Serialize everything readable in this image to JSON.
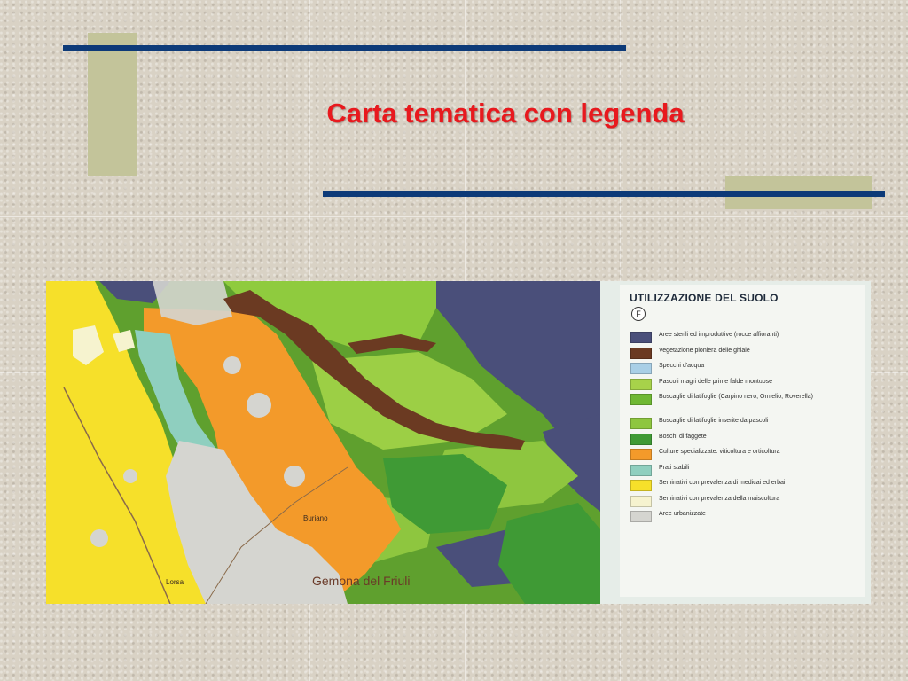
{
  "slide": {
    "title": "Carta tematica con legenda"
  },
  "map": {
    "place_labels": [
      "Gemona del Friuli",
      "Buriano",
      "Lorsa"
    ],
    "legend": {
      "title": "UTILIZZAZIONE DEL SUOLO",
      "badge": "F",
      "items": [
        {
          "color": "#4a4f7a",
          "label": "Aree sterili ed improduttive (rocce affioranti)"
        },
        {
          "color": "#6b3a22",
          "label": "Vegetazione pioniera delle ghiaie"
        },
        {
          "color": "#a9cfe6",
          "label": "Specchi d'acqua"
        },
        {
          "color": "#a7d24a",
          "label": "Pascoli magri delle prime falde montuose"
        },
        {
          "color": "#6fb833",
          "label": "Boscaglie di latifoglie (Carpino nero, Ornielio, Roverella)"
        },
        {
          "color": "#8ec63f",
          "label": "Boscaglie di latifoglie inserite da pascoli"
        },
        {
          "color": "#3f9a35",
          "label": "Boschi di faggete"
        },
        {
          "color": "#f39a2a",
          "label": "Culture specializzate: viticoltura e orticoltura"
        },
        {
          "color": "#8fcfbf",
          "label": "Prati stabili"
        },
        {
          "color": "#f6e02a",
          "label": "Seminativi con prevalenza di medicai ed erbai"
        },
        {
          "color": "#f6f3cf",
          "label": "Seminativi con prevalenza della maiscoltura"
        },
        {
          "color": "#d5d5d0",
          "label": "Aree urbanizzate"
        }
      ]
    }
  },
  "colors": {
    "background": "#d9d2c5",
    "accent_rule": "#0d3a78",
    "olive_block": "#c3c49a",
    "title": "#e8191e"
  }
}
